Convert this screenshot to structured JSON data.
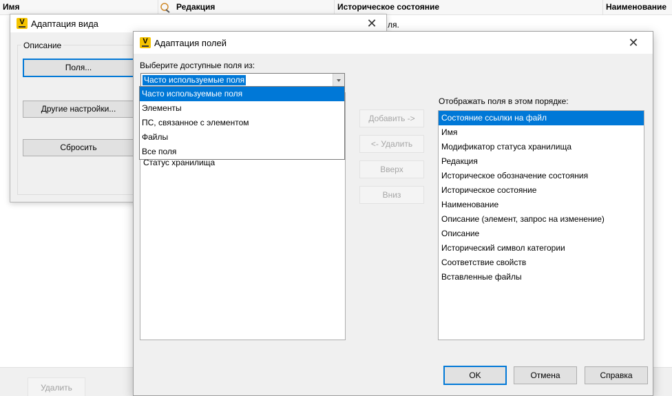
{
  "background": {
    "columns": [
      "Имя",
      "Редакция",
      "Историческое состояние",
      "Наименование"
    ],
    "row_text": "ля.",
    "delete_button": "Удалить"
  },
  "view_dialog": {
    "title": "Адаптация вида",
    "group_label": "Описание",
    "fields_button": "Поля...",
    "other_settings_button": "Другие настройки...",
    "reset_button": "Сбросить"
  },
  "fields_dialog": {
    "title": "Адаптация полей",
    "available_label": "Выберите доступные поля из:",
    "combo_value": "Часто используемые поля",
    "dropdown_options": [
      "Часто используемые поля",
      "Элементы",
      "ПС, связанное с элементом",
      "Файлы",
      "Все поля"
    ],
    "available_list_visible_item": "Статус хранилища",
    "buttons": {
      "add": "Добавить ->",
      "remove": "<- Удалить",
      "up": "Вверх",
      "down": "Вниз"
    },
    "order_label": "Отображать поля в этом порядке:",
    "display_fields": [
      "Состояние ссылки на файл",
      "Имя",
      "Модификатор статуса хранилища",
      "Редакция",
      "Историческое обозначение состояния",
      "Историческое состояние",
      "Наименование",
      "Описание (элемент, запрос на изменение)",
      "Описание",
      "Исторический символ категории",
      "Соответствие свойств",
      "Вставленные файлы"
    ],
    "ok": "OK",
    "cancel": "Отмена",
    "help": "Справка"
  },
  "colors": {
    "accent": "#0078d7",
    "app_icon": "#f5c400"
  }
}
